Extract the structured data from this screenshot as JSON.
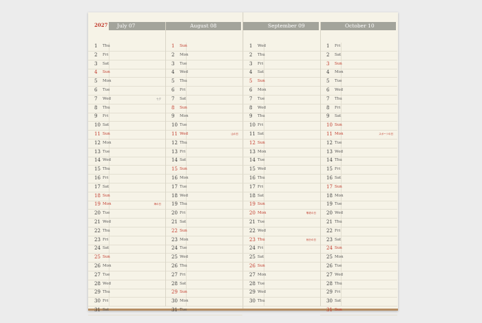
{
  "year": "2027",
  "months": [
    {
      "label": "July 07",
      "days": [
        {
          "n": "1",
          "w": "Thu"
        },
        {
          "n": "2",
          "w": "Fri"
        },
        {
          "n": "3",
          "w": "Sat"
        },
        {
          "n": "4",
          "w": "Sun",
          "red": true
        },
        {
          "n": "5",
          "w": "Mon"
        },
        {
          "n": "6",
          "w": "Tue"
        },
        {
          "n": "7",
          "w": "Wed",
          "note": "七夕",
          "note_grey": true
        },
        {
          "n": "8",
          "w": "Thu"
        },
        {
          "n": "9",
          "w": "Fri"
        },
        {
          "n": "10",
          "w": "Sat"
        },
        {
          "n": "11",
          "w": "Sun",
          "red": true
        },
        {
          "n": "12",
          "w": "Mon"
        },
        {
          "n": "13",
          "w": "Tue"
        },
        {
          "n": "14",
          "w": "Wed"
        },
        {
          "n": "15",
          "w": "Thu"
        },
        {
          "n": "16",
          "w": "Fri"
        },
        {
          "n": "17",
          "w": "Sat"
        },
        {
          "n": "18",
          "w": "Sun",
          "red": true
        },
        {
          "n": "19",
          "w": "Mon",
          "red": true,
          "note": "海の日"
        },
        {
          "n": "20",
          "w": "Tue"
        },
        {
          "n": "21",
          "w": "Wed"
        },
        {
          "n": "22",
          "w": "Thu"
        },
        {
          "n": "23",
          "w": "Fri"
        },
        {
          "n": "24",
          "w": "Sat"
        },
        {
          "n": "25",
          "w": "Sun",
          "red": true
        },
        {
          "n": "26",
          "w": "Mon"
        },
        {
          "n": "27",
          "w": "Tue"
        },
        {
          "n": "28",
          "w": "Wed"
        },
        {
          "n": "29",
          "w": "Thu"
        },
        {
          "n": "30",
          "w": "Fri"
        },
        {
          "n": "31",
          "w": "Sat"
        }
      ]
    },
    {
      "label": "August 08",
      "days": [
        {
          "n": "1",
          "w": "Sun",
          "red": true
        },
        {
          "n": "2",
          "w": "Mon"
        },
        {
          "n": "3",
          "w": "Tue"
        },
        {
          "n": "4",
          "w": "Wed"
        },
        {
          "n": "5",
          "w": "Thu"
        },
        {
          "n": "6",
          "w": "Fri"
        },
        {
          "n": "7",
          "w": "Sat"
        },
        {
          "n": "8",
          "w": "Sun",
          "red": true
        },
        {
          "n": "9",
          "w": "Mon"
        },
        {
          "n": "10",
          "w": "Tue"
        },
        {
          "n": "11",
          "w": "Wed",
          "red": true,
          "note": "山の日"
        },
        {
          "n": "12",
          "w": "Thu"
        },
        {
          "n": "13",
          "w": "Fri"
        },
        {
          "n": "14",
          "w": "Sat"
        },
        {
          "n": "15",
          "w": "Sun",
          "red": true
        },
        {
          "n": "16",
          "w": "Mon"
        },
        {
          "n": "17",
          "w": "Tue"
        },
        {
          "n": "18",
          "w": "Wed"
        },
        {
          "n": "19",
          "w": "Thu"
        },
        {
          "n": "20",
          "w": "Fri"
        },
        {
          "n": "21",
          "w": "Sat"
        },
        {
          "n": "22",
          "w": "Sun",
          "red": true
        },
        {
          "n": "23",
          "w": "Mon"
        },
        {
          "n": "24",
          "w": "Tue"
        },
        {
          "n": "25",
          "w": "Wed"
        },
        {
          "n": "26",
          "w": "Thu"
        },
        {
          "n": "27",
          "w": "Fri"
        },
        {
          "n": "28",
          "w": "Sat"
        },
        {
          "n": "29",
          "w": "Sun",
          "red": true
        },
        {
          "n": "30",
          "w": "Mon"
        },
        {
          "n": "31",
          "w": "Tue"
        }
      ]
    },
    {
      "label": "September 09",
      "days": [
        {
          "n": "1",
          "w": "Wed"
        },
        {
          "n": "2",
          "w": "Thu"
        },
        {
          "n": "3",
          "w": "Fri"
        },
        {
          "n": "4",
          "w": "Sat"
        },
        {
          "n": "5",
          "w": "Sun",
          "red": true
        },
        {
          "n": "6",
          "w": "Mon"
        },
        {
          "n": "7",
          "w": "Tue"
        },
        {
          "n": "8",
          "w": "Wed"
        },
        {
          "n": "9",
          "w": "Thu"
        },
        {
          "n": "10",
          "w": "Fri"
        },
        {
          "n": "11",
          "w": "Sat"
        },
        {
          "n": "12",
          "w": "Sun",
          "red": true
        },
        {
          "n": "13",
          "w": "Mon"
        },
        {
          "n": "14",
          "w": "Tue"
        },
        {
          "n": "15",
          "w": "Wed"
        },
        {
          "n": "16",
          "w": "Thu"
        },
        {
          "n": "17",
          "w": "Fri"
        },
        {
          "n": "18",
          "w": "Sat"
        },
        {
          "n": "19",
          "w": "Sun",
          "red": true
        },
        {
          "n": "20",
          "w": "Mon",
          "red": true,
          "note": "敬老の日"
        },
        {
          "n": "21",
          "w": "Tue"
        },
        {
          "n": "22",
          "w": "Wed"
        },
        {
          "n": "23",
          "w": "Thu",
          "red": true,
          "note": "秋分の日"
        },
        {
          "n": "24",
          "w": "Fri"
        },
        {
          "n": "25",
          "w": "Sat"
        },
        {
          "n": "26",
          "w": "Sun",
          "red": true
        },
        {
          "n": "27",
          "w": "Mon"
        },
        {
          "n": "28",
          "w": "Tue"
        },
        {
          "n": "29",
          "w": "Wed"
        },
        {
          "n": "30",
          "w": "Thu"
        }
      ]
    },
    {
      "label": "October 10",
      "days": [
        {
          "n": "1",
          "w": "Fri"
        },
        {
          "n": "2",
          "w": "Sat"
        },
        {
          "n": "3",
          "w": "Sun",
          "red": true
        },
        {
          "n": "4",
          "w": "Mon"
        },
        {
          "n": "5",
          "w": "Tue"
        },
        {
          "n": "6",
          "w": "Wed"
        },
        {
          "n": "7",
          "w": "Thu"
        },
        {
          "n": "8",
          "w": "Fri"
        },
        {
          "n": "9",
          "w": "Sat"
        },
        {
          "n": "10",
          "w": "Sun",
          "red": true
        },
        {
          "n": "11",
          "w": "Mon",
          "red": true,
          "note": "スポーツの日"
        },
        {
          "n": "12",
          "w": "Tue"
        },
        {
          "n": "13",
          "w": "Wed"
        },
        {
          "n": "14",
          "w": "Thu"
        },
        {
          "n": "15",
          "w": "Fri"
        },
        {
          "n": "16",
          "w": "Sat"
        },
        {
          "n": "17",
          "w": "Sun",
          "red": true
        },
        {
          "n": "18",
          "w": "Mon"
        },
        {
          "n": "19",
          "w": "Tue"
        },
        {
          "n": "20",
          "w": "Wed"
        },
        {
          "n": "21",
          "w": "Thu"
        },
        {
          "n": "22",
          "w": "Fri"
        },
        {
          "n": "23",
          "w": "Sat"
        },
        {
          "n": "24",
          "w": "Sun",
          "red": true
        },
        {
          "n": "25",
          "w": "Mon"
        },
        {
          "n": "26",
          "w": "Tue"
        },
        {
          "n": "27",
          "w": "Wed"
        },
        {
          "n": "28",
          "w": "Thu"
        },
        {
          "n": "29",
          "w": "Fri"
        },
        {
          "n": "30",
          "w": "Sat"
        },
        {
          "n": "31",
          "w": "Sun",
          "red": true
        }
      ]
    }
  ],
  "colors": {
    "holiday": "#c0392b",
    "header_bar": "#a3a49b",
    "paper": "#f6f3e7"
  }
}
